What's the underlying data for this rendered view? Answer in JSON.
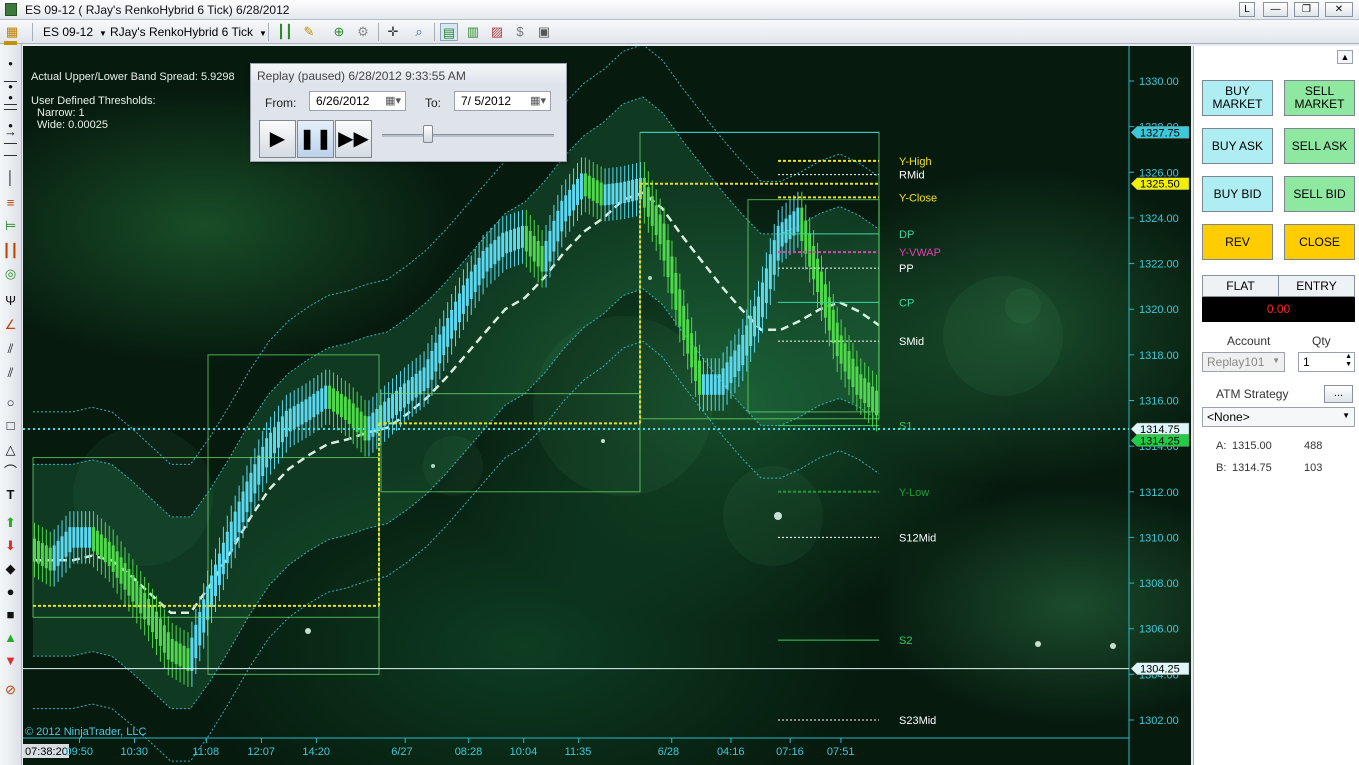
{
  "window": {
    "title": "ES 09-12 ( RJay's RenkoHybrid  6 Tick)  6/28/2012",
    "buttons": [
      "L",
      "—",
      "❐",
      "✕"
    ]
  },
  "toolbar": {
    "instrument": "ES 09-12",
    "period": "RJay's RenkoHybrid  6 Tick"
  },
  "chart": {
    "info": {
      "band_spread": "Actual Upper/Lower Band Spread: 5.9298",
      "thresholds_title": "User Defined Thresholds:",
      "narrow": "Narrow: 1",
      "wide": "Wide: 0.00025"
    },
    "copyright": "© 2012 NinjaTrader, LLC",
    "y_ticks": [
      "1330.00",
      "1328.00",
      "1326.00",
      "1324.00",
      "1322.00",
      "1320.00",
      "1318.00",
      "1316.00",
      "1314.00",
      "1312.00",
      "1310.00",
      "1308.00",
      "1306.00",
      "1304.00",
      "1302.00"
    ],
    "x_ticks": [
      "07:38:20",
      "09:50",
      "10:30",
      "11:08",
      "12:07",
      "14:20",
      "6/27",
      "08:28",
      "10:04",
      "11:35",
      "6/28",
      "04:16",
      "07:16",
      "07:51"
    ],
    "price_markers": [
      {
        "label": "1327.75",
        "bg": "#3cc8d8"
      },
      {
        "label": "1325.50",
        "bg": "#f0f000"
      },
      {
        "label": "1314.75",
        "bg": "#dff6f8"
      },
      {
        "label": "1314.25",
        "bg": "#22cc44"
      },
      {
        "label": "1304.25",
        "bg": "#dff6f8"
      }
    ],
    "levels": [
      {
        "name": "Y-High",
        "price": 1326.5,
        "color": "#f0e020"
      },
      {
        "name": "RMid",
        "price": 1325.9,
        "color": "#ffffff"
      },
      {
        "name": "Y-Close",
        "price": 1324.9,
        "color": "#f0e020"
      },
      {
        "name": "DP",
        "price": 1323.3,
        "color": "#39d8a0"
      },
      {
        "name": "Y-VWAP",
        "price": 1322.5,
        "color": "#e040b0"
      },
      {
        "name": "PP",
        "price": 1321.8,
        "color": "#ffffff"
      },
      {
        "name": "CP",
        "price": 1320.3,
        "color": "#39d8a0"
      },
      {
        "name": "SMid",
        "price": 1318.6,
        "color": "#ffffff"
      },
      {
        "name": "S1",
        "price": 1314.9,
        "color": "#30d060"
      },
      {
        "name": "Y-Low",
        "price": 1312.0,
        "color": "#1e9a36"
      },
      {
        "name": "S12Mid",
        "price": 1310.0,
        "color": "#ffffff"
      },
      {
        "name": "S2",
        "price": 1305.5,
        "color": "#30d060"
      },
      {
        "name": "S23Mid",
        "price": 1302.0,
        "color": "#ffffff"
      }
    ],
    "chart_data": {
      "type": "line",
      "title": "",
      "xlabel": "",
      "ylabel": "",
      "ylim": [
        1301.0,
        1331.0
      ],
      "series": [
        {
          "values": [
            1309.5,
            1309.0,
            1310.0,
            1310.0,
            1309.2,
            1307.9,
            1306.6,
            1305.1,
            1304.6,
            1307.4,
            1309.8,
            1312.0,
            1313.9,
            1315.1,
            1315.6,
            1316.2,
            1315.6,
            1314.7,
            1315.5,
            1316.3,
            1317.0,
            1318.8,
            1320.6,
            1322.1,
            1322.9,
            1323.2,
            1322.1,
            1324.3,
            1325.5,
            1325.0,
            1325.1,
            1325.3,
            1323.3,
            1319.7,
            1316.7,
            1316.7,
            1318.0,
            1320.1,
            1323.2,
            1324.0,
            1321.2,
            1318.4,
            1316.7,
            1315.8
          ]
        },
        {
          "values": [
            1309.0,
            1309.0,
            1309.0,
            1309.2,
            1309.0,
            1308.3,
            1307.5,
            1306.7,
            1306.7,
            1307.9,
            1309.3,
            1310.8,
            1312.1,
            1313.0,
            1313.6,
            1314.1,
            1314.3,
            1314.6,
            1314.8,
            1315.4,
            1316.1,
            1317.0,
            1318.0,
            1319.0,
            1320.0,
            1320.5,
            1321.4,
            1322.5,
            1323.4,
            1324.0,
            1324.8,
            1325.1,
            1324.4,
            1323.2,
            1322.1,
            1321.0,
            1320.0,
            1319.1,
            1319.1,
            1319.5,
            1320.0,
            1320.3,
            1319.9,
            1319.3
          ]
        }
      ]
    }
  },
  "replay": {
    "title": "Replay (paused) 6/28/2012 9:33:55 AM",
    "from_label": "From:",
    "from_value": "6/26/2012",
    "to_label": "To:",
    "to_value": "7/  5/2012",
    "progress": 0.25
  },
  "panel": {
    "buttons": {
      "buy_market": "BUY MARKET",
      "sell_market": "SELL MARKET",
      "buy_ask": "BUY ASK",
      "sell_ask": "SELL ASK",
      "buy_bid": "BUY BID",
      "sell_bid": "SELL BID",
      "rev": "REV",
      "close": "CLOSE"
    },
    "position": {
      "flat": "FLAT",
      "entry": "ENTRY",
      "value": "0.00"
    },
    "account_label": "Account",
    "account_value": "Replay101",
    "qty_label": "Qty",
    "qty_value": "1",
    "atm_label": "ATM Strategy",
    "atm_button": "...",
    "atm_value": "<None>",
    "quotes": [
      {
        "side": "A:",
        "price": "1315.00",
        "size": "488"
      },
      {
        "side": "B:",
        "price": "1314.75",
        "size": "103"
      }
    ]
  }
}
